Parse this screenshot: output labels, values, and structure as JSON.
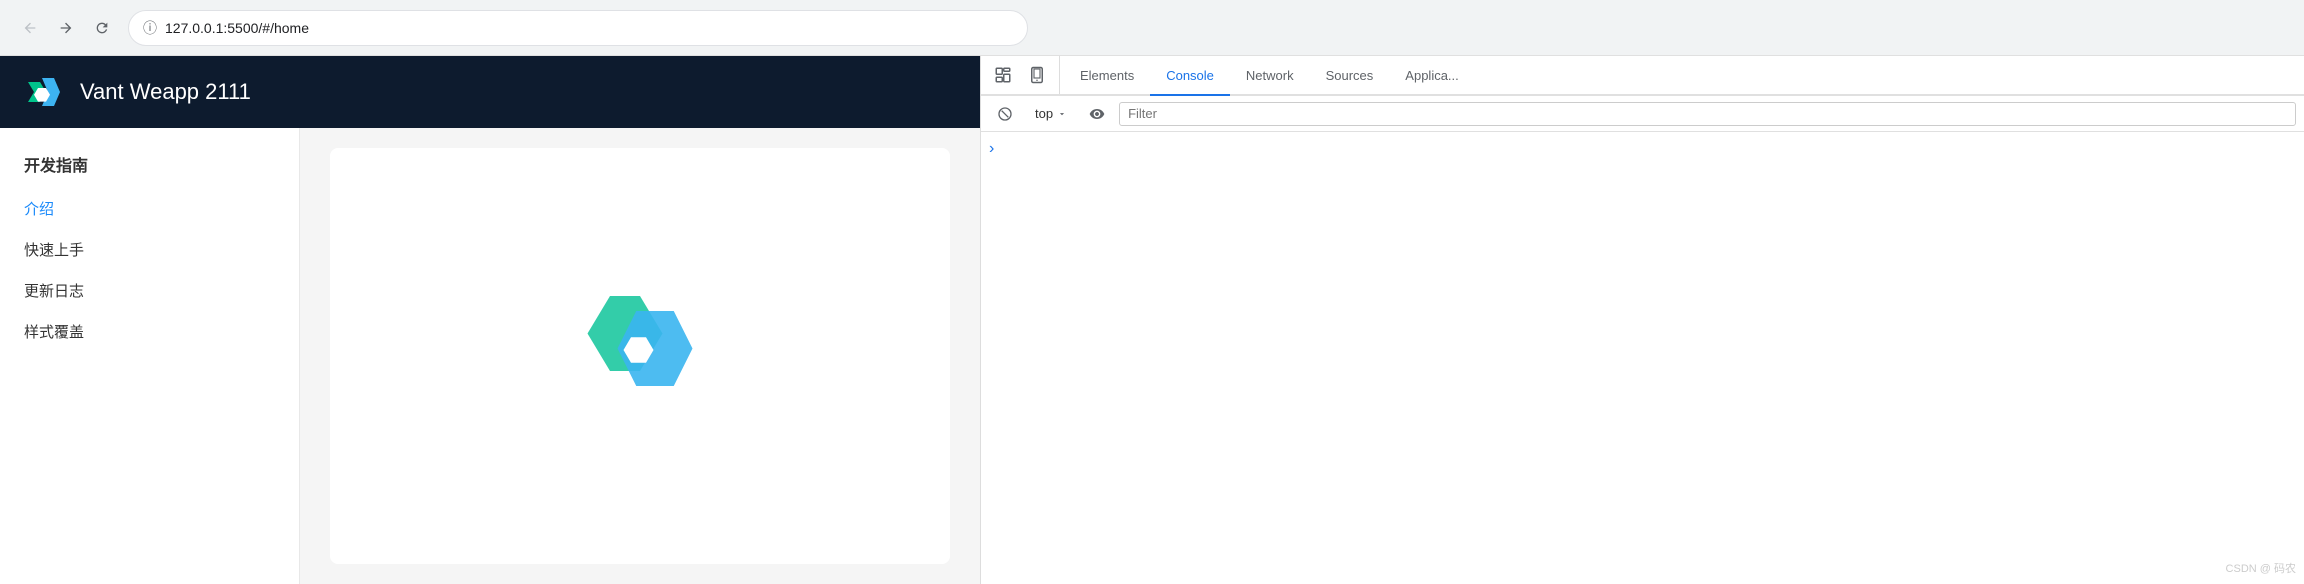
{
  "browser": {
    "back_btn_label": "←",
    "forward_btn_label": "→",
    "reload_btn_label": "↻",
    "url": "127.0.0.1:5500/#/home",
    "info_icon": "ⓘ"
  },
  "app": {
    "title": "Vant Weapp 2111",
    "logo_alt": "vant-logo"
  },
  "sidebar": {
    "section_title": "开发指南",
    "items": [
      {
        "label": "介绍",
        "active": true
      },
      {
        "label": "快速上手",
        "active": false
      },
      {
        "label": "更新日志",
        "active": false
      },
      {
        "label": "样式覆盖",
        "active": false
      }
    ]
  },
  "devtools": {
    "tabs": [
      {
        "label": "Elements",
        "active": false
      },
      {
        "label": "Console",
        "active": true
      },
      {
        "label": "Network",
        "active": false
      },
      {
        "label": "Sources",
        "active": false
      },
      {
        "label": "Applica...",
        "active": false
      }
    ],
    "toolbar": {
      "inspect_icon": "⬚",
      "device_icon": "⬜",
      "block_icon": "⊘",
      "context": "top",
      "eye_icon": "👁",
      "filter_placeholder": "Filter"
    },
    "console_chevron": "›"
  },
  "watermark": "CSDN @ 码农"
}
